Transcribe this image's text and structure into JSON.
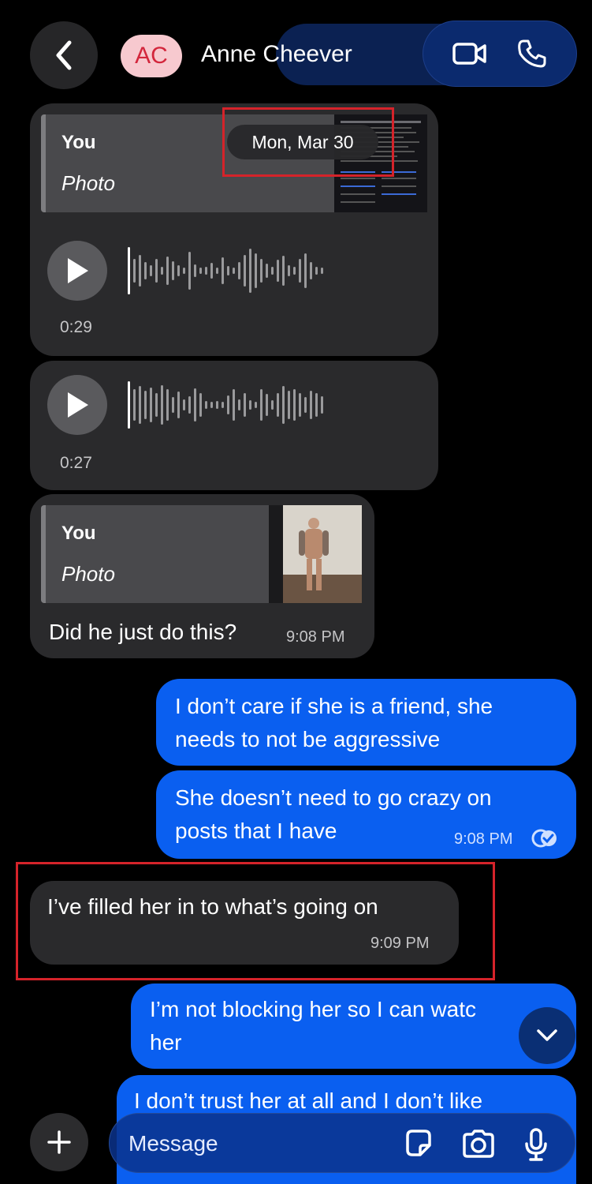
{
  "header": {
    "avatar_initials": "AC",
    "contact_name": "Anne Cheever"
  },
  "date_divider": "Mon, Mar 30",
  "messages": [
    {
      "type": "in_reply_voice",
      "reply_author": "You",
      "reply_kind": "Photo",
      "duration": "0:29"
    },
    {
      "type": "in_voice",
      "duration": "0:27"
    },
    {
      "type": "in_reply_text",
      "reply_author": "You",
      "reply_kind": "Photo",
      "text": "Did he just do this?",
      "time": "9:08 PM"
    },
    {
      "type": "out",
      "text_lines": [
        "I don’t care if she is a friend, she",
        "needs to not be aggressive"
      ]
    },
    {
      "type": "out",
      "text_lines": [
        "She doesn’t need to go crazy on",
        "posts that I have"
      ],
      "time": "9:08 PM",
      "status": "read"
    },
    {
      "type": "in",
      "text": "I’ve filled her in to what’s going on",
      "time": "9:09 PM"
    },
    {
      "type": "out",
      "text_lines": [
        "I’m not blocking her so I can watc",
        "her"
      ]
    },
    {
      "type": "out",
      "text_lines": [
        "I don’t trust her at all and I don’t like"
      ]
    }
  ],
  "composer": {
    "placeholder": "Message"
  },
  "colors": {
    "incoming_bubble": "#2a2a2c",
    "outgoing_bubble": "#0a5ff0",
    "annotation_box": "#d5232a"
  }
}
